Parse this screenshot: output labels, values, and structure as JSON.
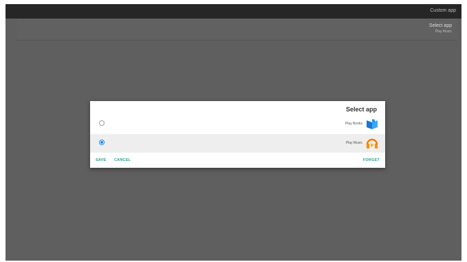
{
  "topbar": {
    "title": "Custom app"
  },
  "panel": {
    "title": "Select app",
    "subtitle": "Play Music"
  },
  "dialog": {
    "title": "Select app",
    "options": [
      {
        "label": "Play Books",
        "icon": "play-books-icon",
        "selected": false
      },
      {
        "label": "Play Music",
        "icon": "play-music-icon",
        "selected": true
      }
    ],
    "buttons": {
      "cancel": "CANCEL",
      "save": "SAVE",
      "forget": "FORGET"
    }
  },
  "colors": {
    "accent": "#1e88e5",
    "button_text": "#2e9c8a",
    "screen_bg": "#5f5f5f",
    "topbar_bg": "#262626"
  }
}
